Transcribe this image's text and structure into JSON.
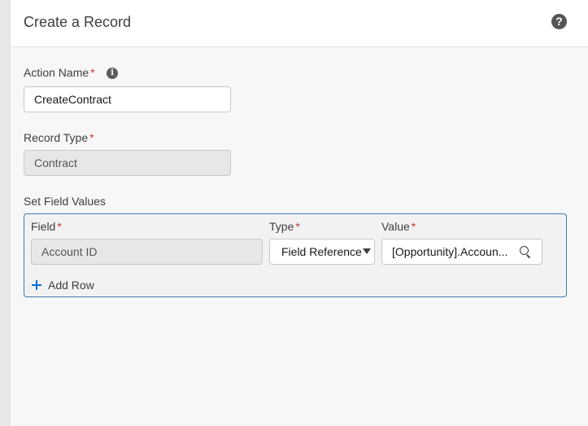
{
  "header": {
    "title": "Create a Record",
    "help_icon_glyph": "?"
  },
  "action_name": {
    "label": "Action Name",
    "required_mark": "*",
    "info_icon_glyph": "i",
    "value": "CreateContract"
  },
  "record_type": {
    "label": "Record Type",
    "required_mark": "*",
    "value": "Contract"
  },
  "field_values": {
    "section_label": "Set Field Values",
    "columns": {
      "field": "Field",
      "type": "Type",
      "value": "Value",
      "required_mark": "*"
    },
    "rows": [
      {
        "field": "Account ID",
        "type": "Field Reference",
        "value": "[Opportunity].Accoun..."
      }
    ],
    "add_row_label": "Add Row"
  },
  "icons": {
    "help": "question-circle-icon",
    "info": "info-icon",
    "caret": "chevron-down-icon",
    "search": "search-icon",
    "add": "plus-icon"
  },
  "colors": {
    "required": "#c23934",
    "accent": "#0070d2",
    "focus_border": "#3e7bb0"
  }
}
